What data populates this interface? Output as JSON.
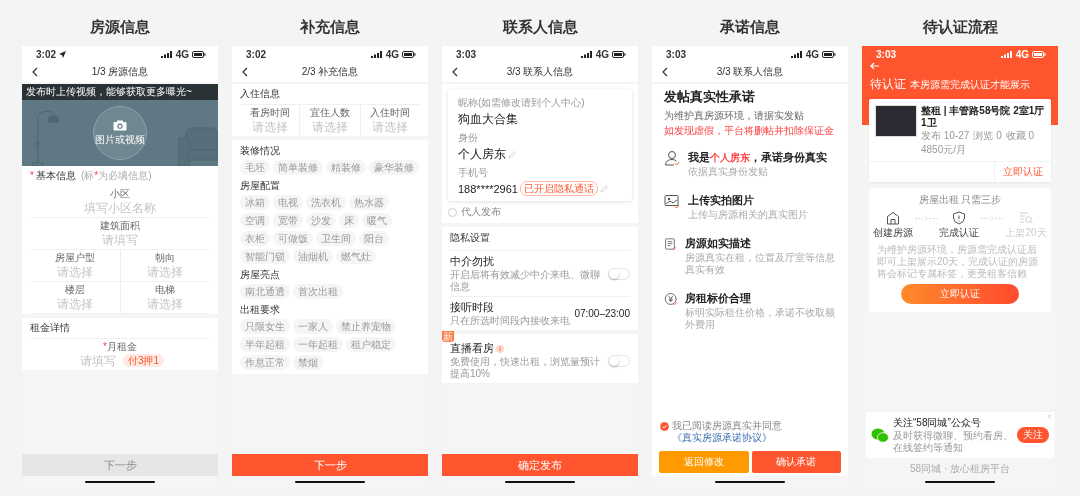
{
  "screens": [
    {
      "kind": "house",
      "heading": "房源信息",
      "time": "3:02",
      "location_on": true,
      "network": "4G",
      "nav_title": "1/3 房源信息",
      "tip": "发布时上传视频，能够获取更多曝光~",
      "upload_label": "图片或视频",
      "section": {
        "mark": "*",
        "title": "基本信息",
        "hint_open": "(标",
        "hint_mark": "*",
        "hint_close": "为必填信息)"
      },
      "fields": [
        {
          "label": "小区",
          "placeholder": "填写小区名称"
        },
        {
          "label": "建筑面积",
          "placeholder": "请填写"
        }
      ],
      "pairs": [
        [
          {
            "label": "房屋户型",
            "placeholder": "请选择"
          },
          {
            "label": "朝向",
            "placeholder": "请选择"
          }
        ],
        [
          {
            "label": "楼层",
            "placeholder": "请选择"
          },
          {
            "label": "电梯",
            "placeholder": "请选择"
          }
        ]
      ],
      "rent_section": "租金详情",
      "rent": {
        "mark": "*",
        "label": "月租金",
        "placeholder": "请填写",
        "badge": "付3押1"
      },
      "button": {
        "label": "下一步",
        "disabled": true
      }
    },
    {
      "kind": "extra",
      "heading": "补充信息",
      "time": "3:02",
      "location_on": false,
      "network": "4G",
      "nav_title": "2/3 补充信息",
      "checkin_section": "入住信息",
      "checkin_fields": [
        {
          "label": "看房时间",
          "placeholder": "请选择"
        },
        {
          "label": "宜住人数",
          "placeholder": "请选择"
        },
        {
          "label": "入住时间",
          "placeholder": "请选择"
        }
      ],
      "groups": [
        {
          "title": "装修情况",
          "tags": [
            {
              "label": "毛坯",
              "selected": false
            },
            {
              "label": "简单装修",
              "selected": false
            },
            {
              "label": "精装修",
              "selected": false
            },
            {
              "label": "豪华装修",
              "selected": false
            }
          ]
        },
        {
          "title": "房屋配置",
          "tags": [
            {
              "label": "冰箱",
              "selected": false
            },
            {
              "label": "电视",
              "selected": false
            },
            {
              "label": "洗衣机",
              "selected": false
            },
            {
              "label": "热水器",
              "selected": false
            },
            {
              "label": "空调",
              "selected": false
            },
            {
              "label": "宽带",
              "selected": false
            },
            {
              "label": "沙发",
              "selected": false
            },
            {
              "label": "床",
              "selected": false
            },
            {
              "label": "暖气",
              "selected": false
            },
            {
              "label": "衣柜",
              "selected": false
            },
            {
              "label": "可做饭",
              "selected": false
            },
            {
              "label": "卫生间",
              "selected": false
            },
            {
              "label": "阳台",
              "selected": false
            },
            {
              "label": "智能门锁",
              "selected": false
            },
            {
              "label": "油烟机",
              "selected": false
            },
            {
              "label": "燃气灶",
              "selected": false
            }
          ]
        },
        {
          "title": "房屋亮点",
          "tags": [
            {
              "label": "南北通透",
              "selected": false
            },
            {
              "label": "首次出租",
              "selected": false
            }
          ]
        },
        {
          "title": "出租要求",
          "tags": [
            {
              "label": "只限女生",
              "selected": false
            },
            {
              "label": "一家人",
              "selected": false
            },
            {
              "label": "禁止养宠物",
              "selected": false
            },
            {
              "label": "半年起租",
              "selected": false
            },
            {
              "label": "一年起租",
              "selected": false
            },
            {
              "label": "租户稳定",
              "selected": false
            },
            {
              "label": "作息正常",
              "selected": false
            },
            {
              "label": "禁烟",
              "selected": false
            }
          ]
        }
      ],
      "button": {
        "label": "下一步",
        "disabled": false
      }
    },
    {
      "kind": "contact",
      "heading": "联系人信息",
      "time": "3:03",
      "location_on": false,
      "network": "4G",
      "nav_title": "3/3 联系人信息",
      "nickname_label": "昵称(如需修改请到个人中心)",
      "nickname": "狗血大合集",
      "identity_label": "身份",
      "identity": "个人房东",
      "phone_label": "手机号",
      "phone": "188****2961",
      "phone_badge": "已开启隐私通话",
      "agent": {
        "label": "代人发布",
        "checked": false
      },
      "privacy_section": "隐私设置",
      "settings": [
        {
          "kind": "toggle",
          "title": "中介勿扰",
          "desc": "开启后将有效减少中介来电、微聊信息",
          "on": false
        },
        {
          "kind": "value",
          "title": "接听时段",
          "desc": "只在所选时间段内接收来电",
          "value": "07:00–23:00"
        }
      ],
      "live": {
        "tag": "新",
        "title": "直播看房",
        "desc": "免费使用，快速出租，浏览量预计提高10%",
        "on": false
      },
      "button": {
        "label": "确定发布",
        "disabled": false
      }
    },
    {
      "kind": "promise",
      "heading": "承诺信息",
      "time": "3:03",
      "location_on": false,
      "network": "4G",
      "nav_title": "3/3 联系人信息",
      "title": "发帖真实性承诺",
      "subtitle": "为维护真房源环境，请据实发贴",
      "warning": "如发现虚假，平台将删帖并扣除保证金",
      "items": [
        {
          "kind": "person",
          "title": "我是",
          "highlight": "个人房东",
          "title_end": "，承诺身份真实",
          "desc": "依据真实身份发贴"
        },
        {
          "kind": "picture",
          "title": "上传实拍图片",
          "desc": "上传与房源相关的真实图片"
        },
        {
          "kind": "document",
          "title": "房源如实描述",
          "desc": "房源真实在租，位置及厅室等信息真实有效"
        },
        {
          "kind": "price",
          "title": "房租标价合理",
          "desc": "标明实际租住价格，承诺不收取额外费用"
        }
      ],
      "agreement": {
        "checked": true,
        "text": "我已阅读房源真实并同意",
        "link": "《真实房源承诺协议》"
      },
      "buttons": [
        {
          "kind": "secondary",
          "label": "返回修改"
        },
        {
          "kind": "primary",
          "label": "确认承诺"
        }
      ]
    },
    {
      "kind": "verify",
      "heading": "待认证流程",
      "time": "3:03",
      "location_on": false,
      "network": "4G",
      "status": "待认证",
      "status_hint": "本房源需完成认证才能展示",
      "listing": {
        "title": "整租 | 丰管路58号院 2室1厅1卫",
        "stats": [
          "发布 10-27",
          "浏览 0",
          "收藏 0"
        ],
        "price": "4850元/月",
        "action": "立即认证"
      },
      "steps_title": "房屋出租 只需三步",
      "steps": [
        {
          "kind": "house",
          "label": "创建房源",
          "disabled": false
        },
        {
          "kind": "shield",
          "label": "完成认证",
          "disabled": false
        },
        {
          "kind": "list",
          "label": "上架20天",
          "disabled": true
        }
      ],
      "note": "为维护房源环境，房源需完成认证后即可上架展示20天，完成认证的房源将会标记专属标签，更受租客信赖",
      "button": "立即认证",
      "follow": {
        "title": "关注“58同城”公众号",
        "desc": "及时获得微聊、预约看房、在线签约等通知",
        "button": "关注"
      },
      "footer": "58同城 · 放心租房平台"
    }
  ]
}
